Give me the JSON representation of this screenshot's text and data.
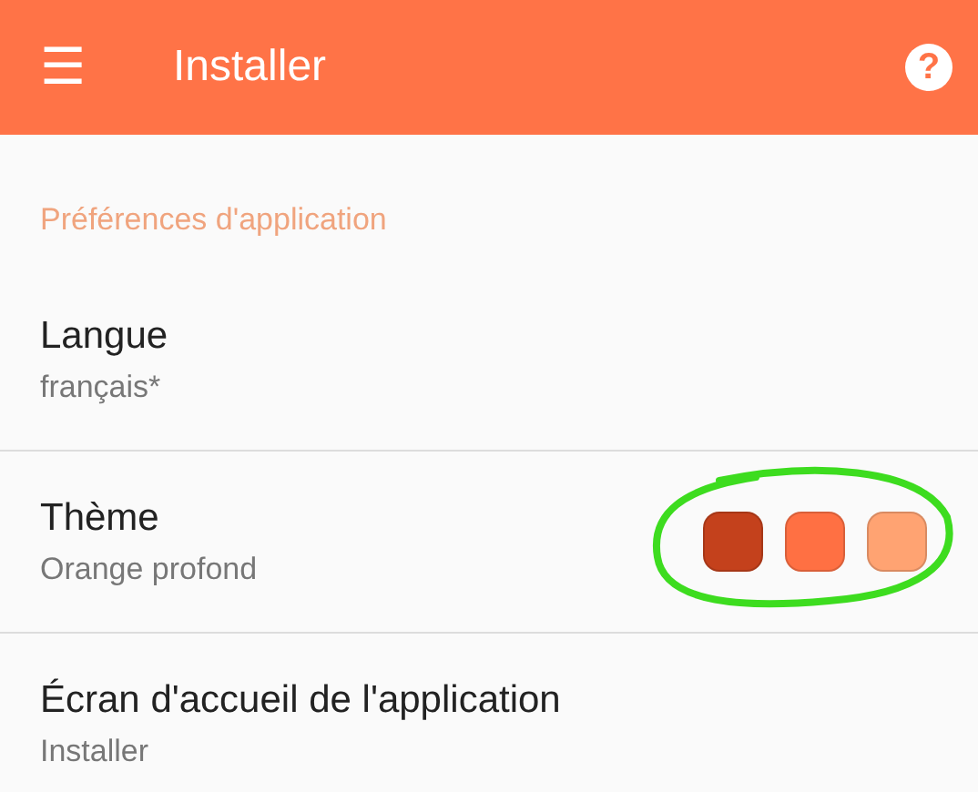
{
  "app_bar": {
    "menu_icon": "☰",
    "title": "Installer",
    "help_icon": "?"
  },
  "section": {
    "title": "Préférences d'application"
  },
  "items": [
    {
      "kind": "text",
      "title": "Langue",
      "summary": "français*"
    },
    {
      "kind": "swatches",
      "title": "Thème",
      "summary": "Orange profond",
      "swatches": [
        {
          "color": "#c4411c"
        },
        {
          "color": "#ff7043"
        },
        {
          "color": "#ffa372"
        }
      ]
    },
    {
      "kind": "text",
      "title": "Écran d'accueil de l'application",
      "summary": "Installer"
    }
  ]
}
